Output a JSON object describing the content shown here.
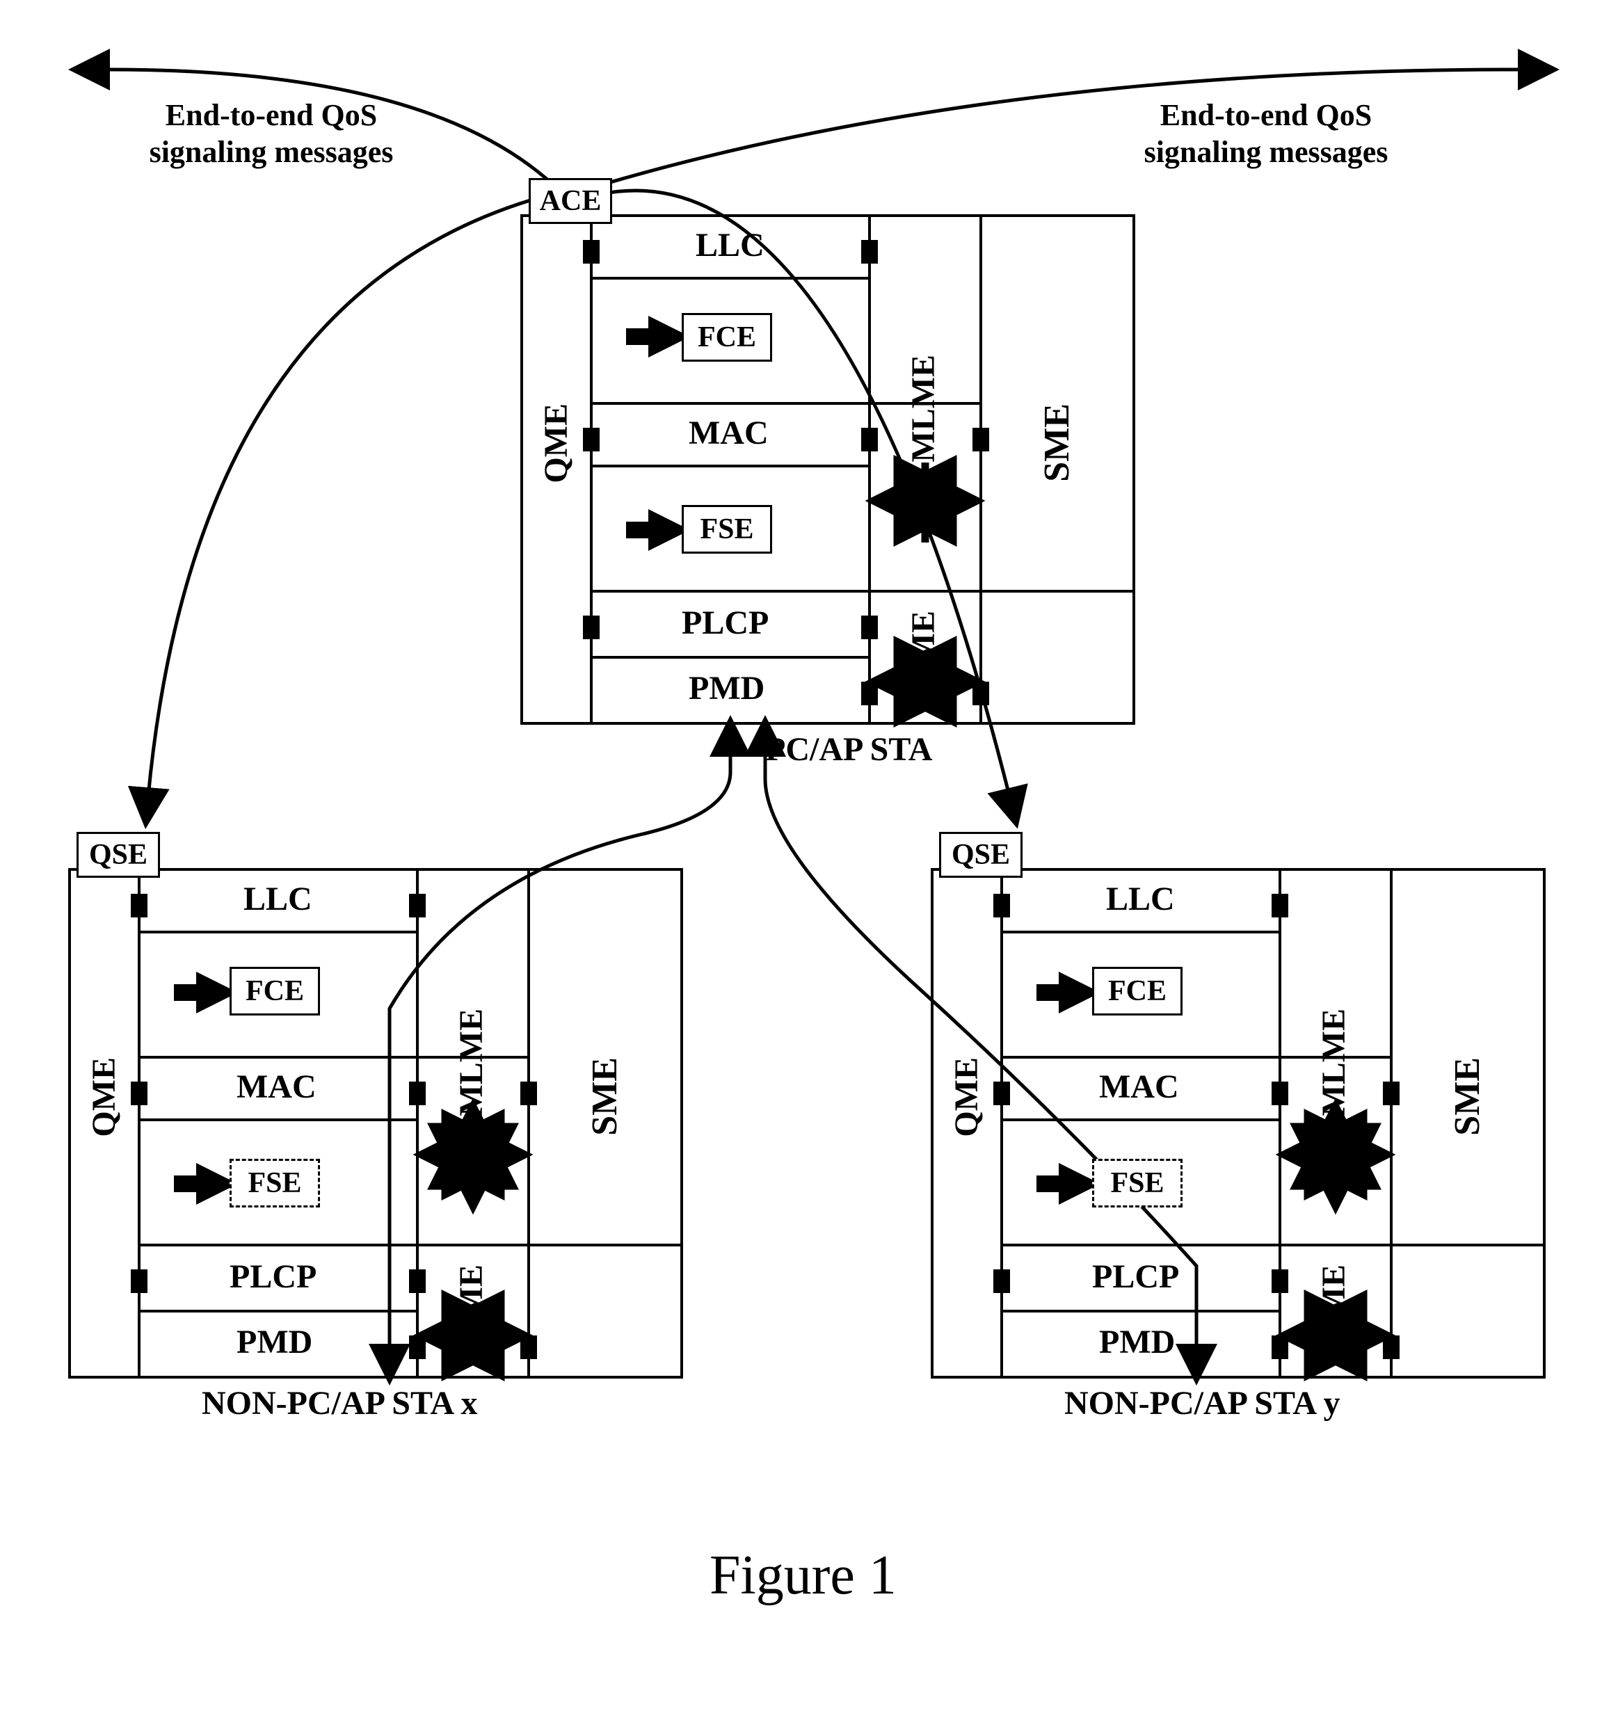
{
  "figure_caption": "Figure 1",
  "msg_left": "End-to-end QoS signaling messages",
  "msg_right": "End-to-end QoS signaling messages",
  "station_top": {
    "caption": "PC/AP STA",
    "qme": "QME",
    "sme": "SME",
    "ace": "ACE",
    "llc": "LLC",
    "fce": "FCE",
    "mac": "MAC",
    "fse": "FSE",
    "mlme": "MLME",
    "plcp": "PLCP",
    "pmd": "PMD",
    "plme": "PLME"
  },
  "station_left": {
    "caption": "NON-PC/AP STA x",
    "qme": "QME",
    "sme": "SME",
    "qse": "QSE",
    "llc": "LLC",
    "fce": "FCE",
    "mac": "MAC",
    "fse": "FSE",
    "mlme": "MLME",
    "plcp": "PLCP",
    "pmd": "PMD",
    "plme": "PLME"
  },
  "station_right": {
    "caption": "NON-PC/AP STA y",
    "qme": "QME",
    "sme": "SME",
    "qse": "QSE",
    "llc": "LLC",
    "fce": "FCE",
    "mac": "MAC",
    "fse": "FSE",
    "mlme": "MLME",
    "plcp": "PLCP",
    "pmd": "PMD",
    "plme": "PLME"
  }
}
